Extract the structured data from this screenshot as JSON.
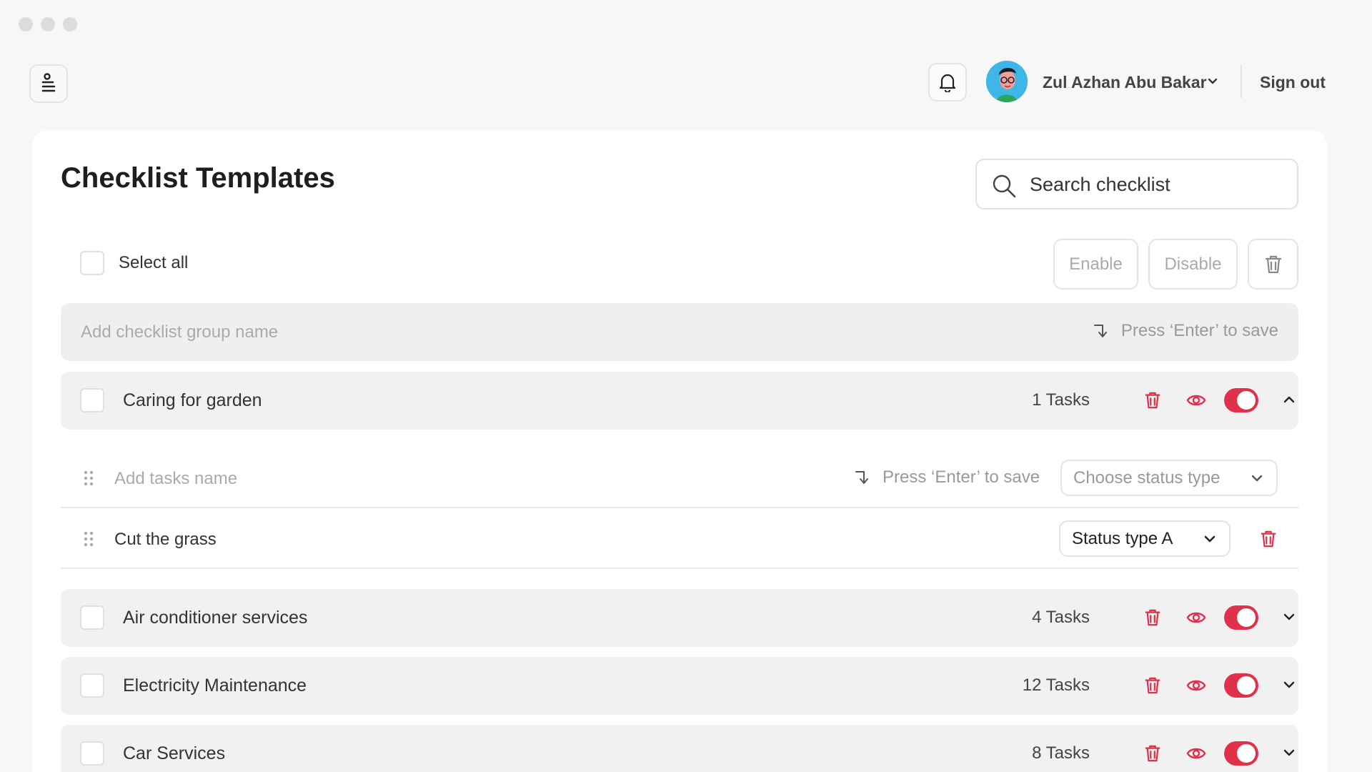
{
  "header": {
    "user_name": "Zul Azhan Abu Bakar",
    "sign_out_label": "Sign out"
  },
  "page": {
    "title": "Checklist Templates",
    "search_placeholder": "Search checklist"
  },
  "toolbar": {
    "select_all_label": "Select all",
    "enable_label": "Enable",
    "disable_label": "Disable"
  },
  "group_input": {
    "placeholder": "Add checklist group name",
    "save_hint": "Press ‘Enter’ to save"
  },
  "groups": [
    {
      "name": "Caring for garden",
      "task_count": "1 Tasks",
      "enabled": true,
      "expanded": true
    },
    {
      "name": "Air conditioner services",
      "task_count": "4 Tasks",
      "enabled": true,
      "expanded": false
    },
    {
      "name": "Electricity Maintenance",
      "task_count": "12 Tasks",
      "enabled": true,
      "expanded": false
    },
    {
      "name": "Car Services",
      "task_count": "8 Tasks",
      "enabled": true,
      "expanded": false
    }
  ],
  "task_input": {
    "placeholder": "Add tasks name",
    "save_hint": "Press ‘Enter’ to save",
    "status_placeholder": "Choose status type"
  },
  "tasks": [
    {
      "name": "Cut the grass",
      "status": "Status type A"
    }
  ],
  "colors": {
    "accent": "#e0304a",
    "background": "#f7f7f7",
    "row_background": "#f1f1f1"
  }
}
